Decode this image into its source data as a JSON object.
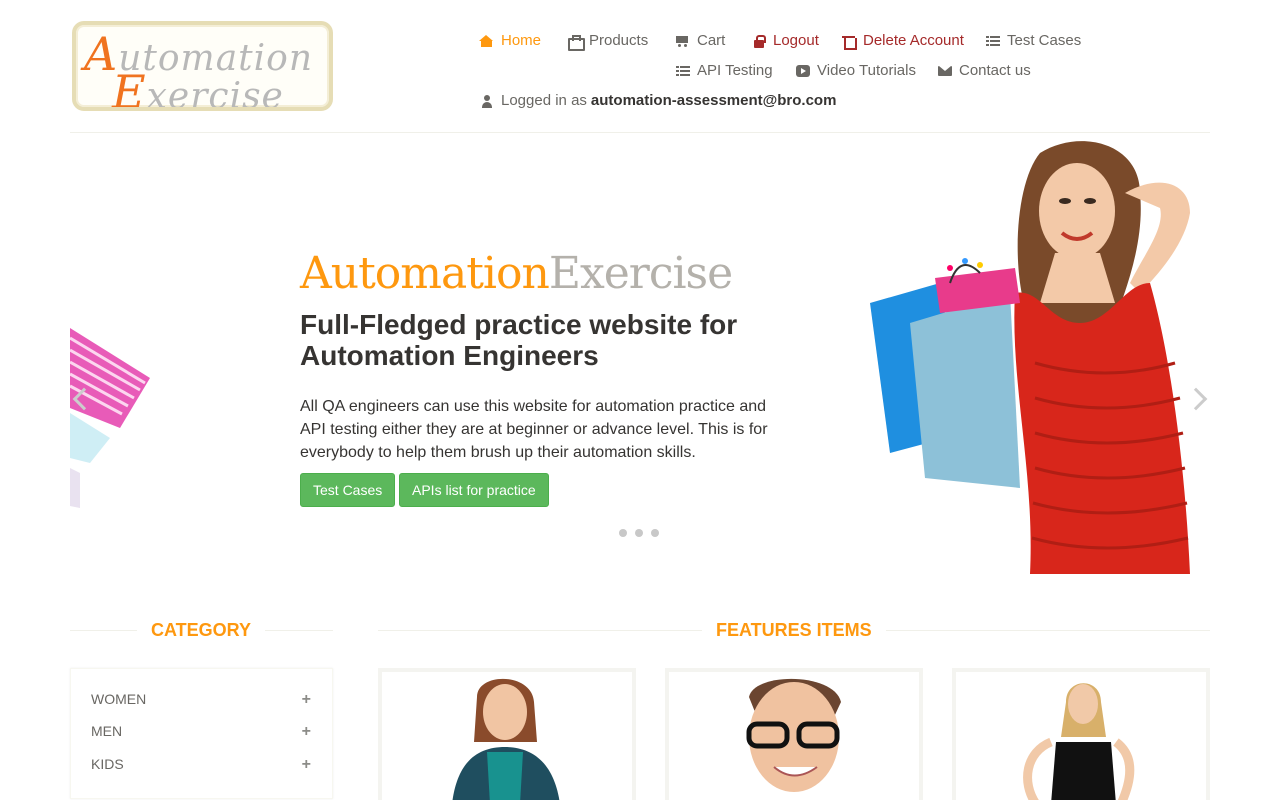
{
  "logo": {
    "line1_cap": "A",
    "line1_rest": "utomation",
    "line2_cap": "E",
    "line2_rest": "xercise"
  },
  "nav": {
    "home": "Home",
    "products": "Products",
    "cart": "Cart",
    "logout": "Logout",
    "delete_account": "Delete Account",
    "test_cases": "Test Cases",
    "api_testing": "API Testing",
    "video_tutorials": "Video Tutorials",
    "contact_us": "Contact us",
    "logged_in_prefix": "Logged in as",
    "logged_in_user": "automation-assessment@bro.com"
  },
  "hero": {
    "brand_part1": "Automation",
    "brand_part2": "Exercise",
    "heading": "Full-Fledged practice website for Automation Engineers",
    "text": "All QA engineers can use this website for automation practice and API testing either they are at beginner or advance level. This is for everybody to help them brush up their automation skills.",
    "btn_test_cases": "Test Cases",
    "btn_apis": "APIs list for practice",
    "slide_count": 3
  },
  "sections": {
    "category": "Category",
    "features": "Features Items"
  },
  "categories": [
    {
      "label": "Women",
      "toggle": "+"
    },
    {
      "label": "Men",
      "toggle": "+"
    },
    {
      "label": "Kids",
      "toggle": "+"
    }
  ],
  "colors": {
    "accent": "#fe980f",
    "danger": "#a52a2a",
    "button_green": "#5cb85c",
    "text": "#696763",
    "heading": "#363432"
  }
}
